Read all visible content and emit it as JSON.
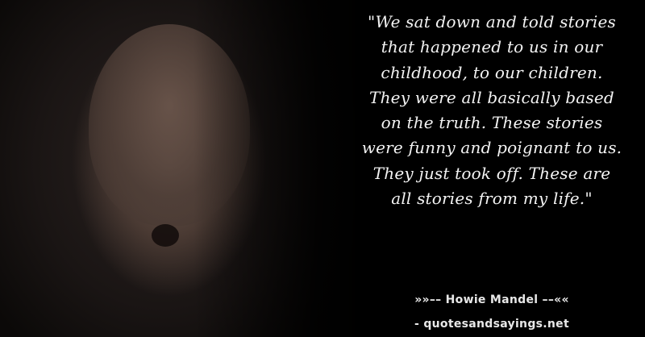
{
  "quote": {
    "lines": [
      "\"We sat down and told stories",
      "that happened to us in our",
      "childhood, to our children.",
      "They were all basically based",
      "on the truth. These stories",
      "were funny and poignant to us.",
      "They just took off. These are",
      "all stories from my life.\""
    ]
  },
  "author_line": "»»–– Howie Mandel ––««",
  "source_line": "- quotesandsayings.net"
}
